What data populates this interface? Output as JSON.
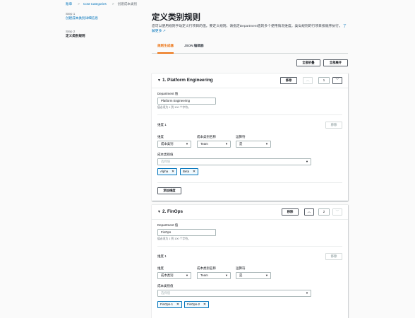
{
  "breadcrumb": [
    "账单",
    "Cost Categories",
    "创建成本类别"
  ],
  "nav": {
    "steps": [
      {
        "step": "Step 1",
        "label": "创建成本类别详细信息"
      },
      {
        "step": "Step 2",
        "label": "定义类别规则"
      }
    ]
  },
  "page": {
    "title": "定义类别规则",
    "description": "您可以使用规则手动定义行项目的值。要定义规则，请指定Department值的多个使用情况维度。类似规则的行项目按顺序执行。",
    "learn_more": "了解更多"
  },
  "tabs": [
    "规则生成器",
    "JSON 编辑器"
  ],
  "actions": {
    "collapse_all": "全部折叠",
    "expand_all": "全部展开"
  },
  "rules": [
    {
      "title": "1. Platform Engineering",
      "remove": "移除",
      "order": "1",
      "dept_label": "Department 值",
      "dept_value": "Platform Engineering",
      "dept_hint": "值必须为 1 到 100 个字符。",
      "dimension_label": "维度 1",
      "dimension_remove": "移除",
      "col_dimension": "维度",
      "col_key": "成本类别名称",
      "col_operator": "运算符",
      "dimension_value": "成本类别",
      "key_value": "Team",
      "operator_value": "是",
      "values_label": "成本类别值",
      "values_placeholder": "选择值",
      "tokens": [
        "Alpha",
        "Beta"
      ],
      "add_dimension": "添加维度"
    },
    {
      "title": "2. FinOps",
      "remove": "移除",
      "order": "2",
      "dept_label": "Department 值",
      "dept_value": "FinOps",
      "dept_hint": "值必须为 1 到 100 个字符。",
      "dimension_label": "维度 1",
      "dimension_remove": "移除",
      "col_dimension": "维度",
      "col_key": "成本类别名称",
      "col_operator": "运算符",
      "dimension_value": "成本类别",
      "key_value": "Team",
      "operator_value": "是",
      "values_label": "成本类别值",
      "values_placeholder": "选择值",
      "tokens": [
        "FinOps-1",
        "FinOps-2"
      ]
    }
  ],
  "colors": {
    "accent": "#ec7211",
    "link": "#0073bb"
  }
}
